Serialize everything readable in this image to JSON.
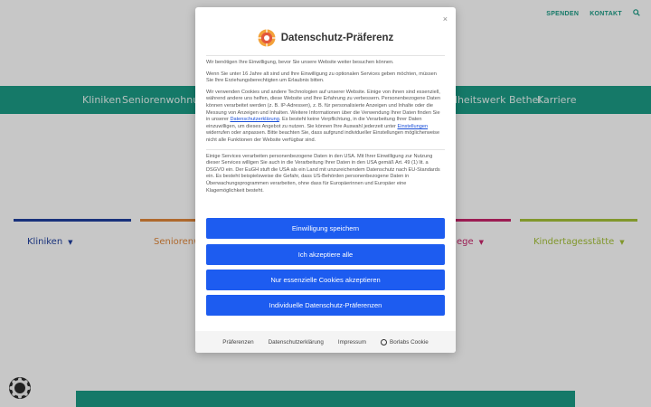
{
  "topbar": {
    "links": [
      "SPENDEN",
      "KONTAKT"
    ],
    "search_icon": "search-icon"
  },
  "nav": {
    "items": [
      "Kliniken",
      "Seniorenwohnungen",
      "ndheitswerk Bethel",
      "Karriere"
    ]
  },
  "sections": [
    {
      "label": "Kliniken",
      "color": "#1f3f9e"
    },
    {
      "label": "Seniorenw",
      "color": "#e0873a"
    },
    {
      "label": "ege",
      "color": "#c8256b"
    },
    {
      "label": "Kindertagesstätte",
      "color": "#a6c239"
    }
  ],
  "modal": {
    "title": "Datenschutz-Präferenz",
    "close_label": "×",
    "p1": "Wir benötigen Ihre Einwilligung, bevor Sie unsere Website weiter besuchen können.",
    "p2": "Wenn Sie unter 16 Jahre alt sind und Ihre Einwilligung zu optionalen Services geben möchten, müssen Sie Ihre Erziehungsberechtigten um Erlaubnis bitten.",
    "p3_a": "Wir verwenden Cookies und andere Technologien auf unserer Website. Einige von ihnen sind essenziell, während andere uns helfen, diese Website und Ihre Erfahrung zu verbessern. Personenbezogene Daten können verarbeitet werden (z. B. IP-Adressen), z. B. für personalisierte Anzeigen und Inhalte oder die Messung von Anzeigen und Inhalten. Weitere Informationen über die Verwendung Ihrer Daten finden Sie in unserer",
    "p3_link": "Datenschutzerklärung",
    "p3_b": ". Es besteht keine Verpflichtung, in die Verarbeitung Ihrer Daten einzuwilligen, um dieses Angebot zu nutzen. Sie können Ihre Auswahl jederzeit unter",
    "p3_link2": "Einstellungen",
    "p3_c": "widerrufen oder anpassen. Bitte beachten Sie, dass aufgrund individueller Einstellungen möglicherweise nicht alle Funktionen der Website verfügbar sind.",
    "p4": "Einige Services verarbeiten personenbezogene Daten in den USA. Mit Ihrer Einwilligung zur Nutzung dieser Services willigen Sie auch in die Verarbeitung Ihrer Daten in den USA gemäß Art. 49 (1) lit. a DSGVO ein. Der EuGH stuft die USA als ein Land mit unzureichendem Datenschutz nach EU-Standards ein. Es besteht beispielsweise die Gefahr, dass US-Behörden personenbezogene Daten in Überwachungsprogrammen verarbeiten, ohne dass für Europäerinnen und Europäer eine Klagemöglichkeit besteht.",
    "buttons": [
      "Einwilligung speichern",
      "Ich akzeptiere alle",
      "Nur essenzielle Cookies akzeptieren",
      "Individuelle Datenschutz-Präferenzen"
    ],
    "button_color": "#1d5cf0",
    "footer": {
      "links": [
        "Präferenzen",
        "Datenschutzerklärung",
        "Impressum"
      ],
      "brand": "Borlabs Cookie"
    }
  },
  "colors": {
    "brand_teal": "#1c9c86"
  }
}
